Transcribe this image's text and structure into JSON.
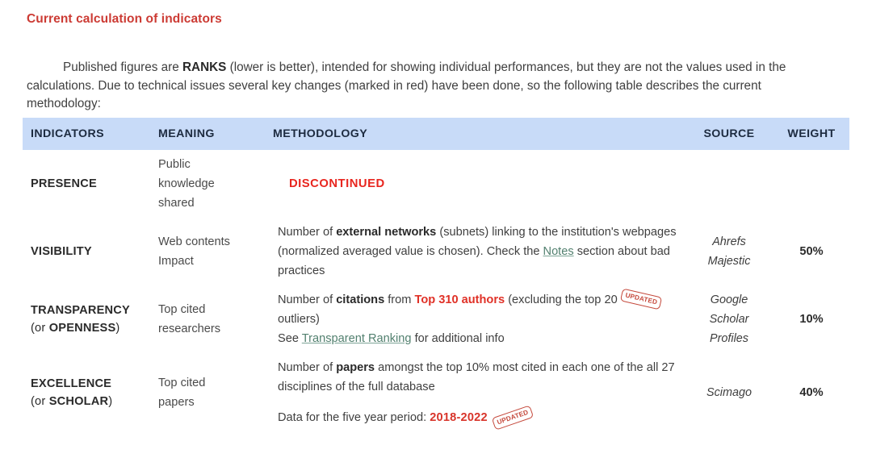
{
  "heading": "Current calculation of indicators",
  "intro": {
    "part1": "Published figures are ",
    "bold1": "RANKS",
    "part2": " (lower is better), intended for showing individual performances, but they are not the values used in the calculations. Due to technical issues several key changes (marked in red) have been done, so the following table describes the current methodology:"
  },
  "table": {
    "headers": {
      "indicators": "INDICATORS",
      "meaning": "MEANING",
      "methodology": "METHODOLOGY",
      "source": "SOURCE",
      "weight": "WEIGHT"
    },
    "rows": [
      {
        "indicator": "PRESENCE",
        "indicator_line2": "",
        "meaning": "Public\nknowledge\nshared",
        "meaning_lines": [
          "Public",
          "knowledge",
          "shared"
        ],
        "methodology_status": "DISCONTINUED",
        "source_lines": [],
        "weight": ""
      },
      {
        "indicator": "VISIBILITY",
        "indicator_line2": "",
        "meaning_lines": [
          "Web contents",
          "Impact"
        ],
        "method": {
          "seg1": "Number of ",
          "bold1": "external networks",
          "seg2": " (subnets) linking to the institution's webpages (normalized averaged value is chosen). Check the ",
          "link1": "Notes",
          "seg3": " section about bad practices"
        },
        "source_lines": [
          "Ahrefs",
          "Majestic"
        ],
        "weight": "50%"
      },
      {
        "indicator": "TRANSPARENCY",
        "indicator_line2": "(or OPENNESS)",
        "indicator_line2_normal": "(or ",
        "indicator_line2_bold": "OPENNESS",
        "indicator_line2_tail": ")",
        "meaning_lines": [
          "Top cited",
          "researchers"
        ],
        "method": {
          "seg1": "Number of ",
          "bold1": "citations",
          "seg2": " from ",
          "red1": "Top 310 authors",
          "seg3": " (excluding the top 20 ",
          "stamp": "UPDATED",
          "seg4": " outliers)",
          "seg5": "See ",
          "link1": "Transparent Ranking",
          "seg6": " for additional info"
        },
        "source_lines": [
          "Google",
          "Scholar",
          "Profiles"
        ],
        "weight": "10%"
      },
      {
        "indicator": "EXCELLENCE",
        "indicator_line2": "(or SCHOLAR)",
        "indicator_line2_normal": "(or ",
        "indicator_line2_bold": "SCHOLAR",
        "indicator_line2_tail": ")",
        "meaning_lines": [
          "Top cited",
          "papers"
        ],
        "method": {
          "seg1": "Number of ",
          "bold1": "papers",
          "seg2": " amongst the top 10% most cited in each one of the all 27 disciplines of the full database",
          "seg3": "Data for the five year period: ",
          "red1": "2018-2022",
          "stamp": "UPDATED"
        },
        "source_lines": [
          "Scimago"
        ],
        "weight": "40%"
      }
    ]
  },
  "colors": {
    "heading_red": "#cc3b34",
    "header_bg": "#c8dbf8",
    "header_text": "#1d2b40",
    "accent_red": "#e03127",
    "discontinued_red": "#e8261f",
    "link_green": "#52806f",
    "stamp_red": "#c0392b",
    "body_text": "#3f3f3f"
  }
}
